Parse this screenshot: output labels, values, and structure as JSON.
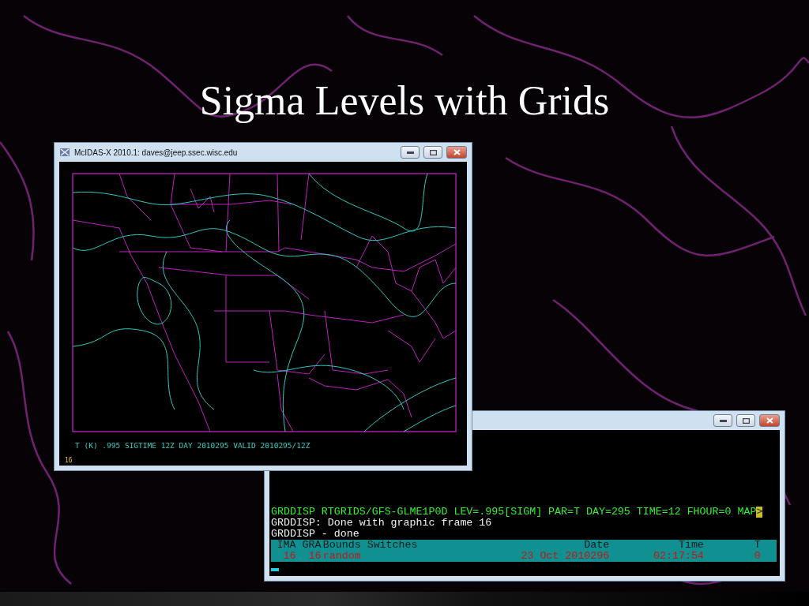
{
  "slide": {
    "title": "Sigma Levels with Grids"
  },
  "image_window": {
    "title": "McIDAS-X 2010.1: daves@jeep.ssec.wisc.edu",
    "caption": "T (K) .995 SIGTIME 12Z DAY 2010295 VALID 2010295/12Z",
    "frame_number": "16"
  },
  "text_window": {
    "lines": [
      {
        "kind": "command",
        "text": "GRDDISP RTGRIDS/GFS-GLME1P0D LEV=.995[SIGM] PAR=T DAY=295 TIME=12 FHOUR=0 MAP",
        "overflow_marker": ">"
      },
      {
        "kind": "output",
        "text": "GRDDISP: Done with graphic frame 16"
      },
      {
        "kind": "output",
        "text": "GRDDISP - done"
      }
    ],
    "table": {
      "columns": [
        "IMA",
        "GRA",
        "Bounds",
        "Switches",
        "Date",
        "Time",
        "T"
      ],
      "rows": [
        [
          "16",
          "16",
          "random",
          "",
          "23 Oct 2010296",
          "02:17:54",
          "0"
        ]
      ]
    }
  }
}
